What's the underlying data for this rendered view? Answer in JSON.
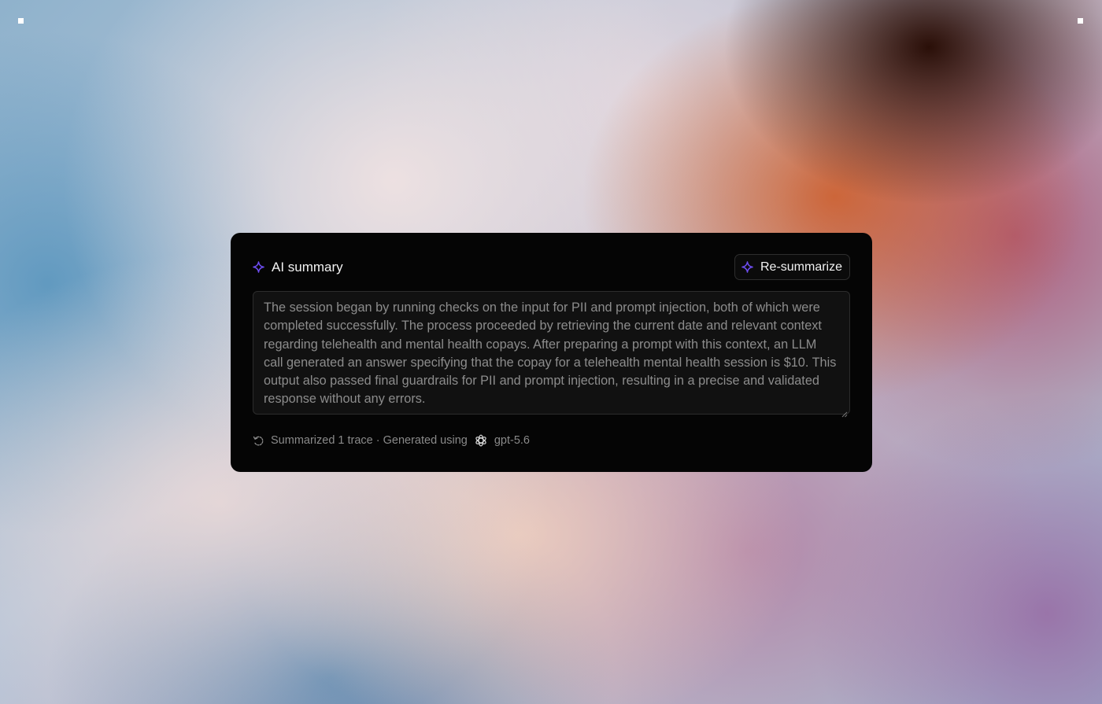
{
  "card": {
    "title": "AI summary",
    "title_icon": "sparkle-icon",
    "resummarize_label": "Re-summarize",
    "summary_text": "The session began by running checks on the input for PII and prompt injection, both of which were completed successfully. The process proceeded by retrieving the current date and relevant context regarding telehealth and mental health copays. After preparing a prompt with this context, an LLM call generated an answer specifying that the copay for a telehealth mental health session is $10. This output also passed final guardrails for PII and prompt injection, resulting in a precise and validated response without any errors.",
    "footer": {
      "status_text": "Summarized 1 trace · Generated using",
      "model_name": "gpt-5.6",
      "model_icon": "openai-logo-icon",
      "status_icon": "refresh-icon"
    }
  },
  "colors": {
    "accent": "#6d4df0",
    "card_background": "#050505",
    "summary_text": "#8c8c8c"
  }
}
